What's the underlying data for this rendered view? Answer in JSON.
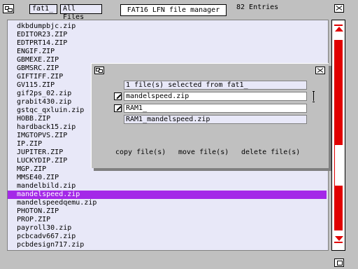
{
  "titlebar": {
    "tabs": [
      "fat1_",
      "All Files"
    ],
    "title": "FAT16 LFN file manager",
    "entries": "82 Entries"
  },
  "files": [
    "dkbdumpbjc.zip",
    "EDITOR23.ZIP",
    "EDTPRT14.ZIP",
    "ENGIF.ZIP",
    "GBMEXE.ZIP",
    "GBMSRC.ZIP",
    "GIFTIFF.ZIP",
    "GV115.ZIP",
    "gif2ps_02.zip",
    "grabit430.zip",
    "gstqc_qxluin.zip",
    "HOBB.ZIP",
    "hardback15.zip",
    "IMGTOPVS.ZIP",
    "IP.ZIP",
    "JUPITER.ZIP",
    "LUCKYDIP.ZIP",
    "MGP.ZIP",
    "MMSE40.ZIP",
    "mandelbild.zip",
    "mandelspeed.zip",
    "mandelspeedqemu.zip",
    "PHOTON.ZIP",
    "PROP.ZIP",
    "payroll30.zip",
    "pcbcadv667.zip",
    "pcbdesign717.zip"
  ],
  "selected_file": "mandelspeed.zip",
  "dialog": {
    "status": "1 file(s) selected from fat1_",
    "source_value": "mandelspeed.zip",
    "dest_value": "RAM1_",
    "result_path": "RAM1_mandelspeed.zip",
    "copy_label": "copy file(s)",
    "move_label": "move file(s)",
    "delete_label": "delete file(s)"
  },
  "colors": {
    "selection": "#a428e8",
    "scrollbar": "#e00000",
    "list_bg": "#e8e8f8"
  }
}
